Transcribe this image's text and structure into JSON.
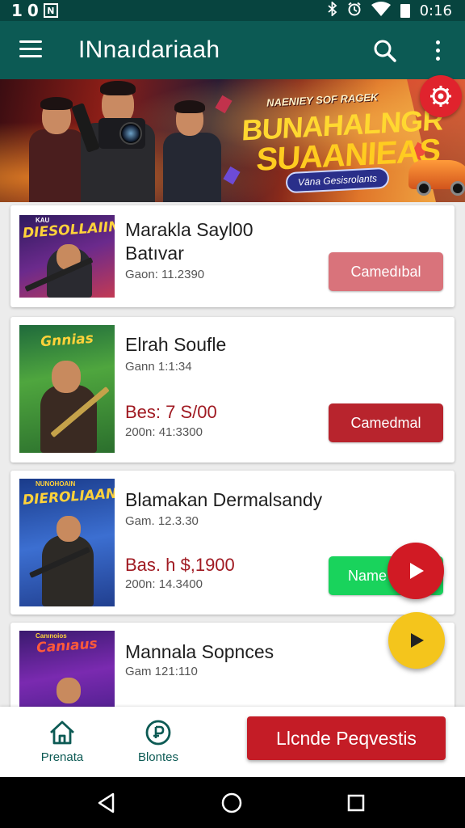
{
  "status_bar": {
    "left_text": "1",
    "left_digit": "0",
    "time": "0:16",
    "icons": [
      "notification-n-icon",
      "bluetooth-icon",
      "alarm-icon",
      "wifi-icon",
      "battery-icon"
    ]
  },
  "app_bar": {
    "title": "INnaıdariaah",
    "icons": [
      "menu-icon",
      "search-icon",
      "more-vert-icon"
    ]
  },
  "banner": {
    "small_text": "NAENIEY SOF RAGEK",
    "title_line1": "BUNAHALNGR",
    "title_line2": "SUAANIEAS",
    "pill_text": "Vāna Gesisrolants",
    "badge_icon": "gear-icon"
  },
  "games": [
    {
      "thumb_title": "DIESOLLAIIN",
      "thumb_sub": "KAU",
      "title": "Marakla Sayl00",
      "title2": "Batıvar",
      "meta": "Gaon: 11.2390",
      "price": "",
      "price_sub": "",
      "button": "Camedıbal",
      "button_color": "#d9737b"
    },
    {
      "thumb_title": "Gnnias",
      "thumb_sub": "",
      "title": "Elrah Soufle",
      "title2": "",
      "meta": "Gann 1:1:34",
      "price": "Bes: 7 S/00",
      "price_sub": "200n: 41:3300",
      "button": "Camedmal",
      "button_color": "#b8242d"
    },
    {
      "thumb_title": "DIEROLIAAN",
      "thumb_sub": "NUNOHOAIN",
      "title": "Blamakan Dermalsandy",
      "title2": "",
      "meta": "Gam. 12.3.30",
      "price": "Bas. h $,1900",
      "price_sub": "200n: 14.3400",
      "button": "Name",
      "button_color": "#19d35c"
    },
    {
      "thumb_title": "Canıaus",
      "thumb_sub": "Canınoios",
      "title": "Mannala Sopnces",
      "title2": "",
      "meta": "Gam 121:110",
      "price": "",
      "price_sub": "",
      "button": "",
      "button_color": "#19d35c"
    }
  ],
  "fabs": [
    {
      "icon": "play-icon",
      "color": "#d11a24"
    },
    {
      "icon": "play-icon",
      "color": "#f4c51c"
    }
  ],
  "bottom_nav": {
    "items": [
      {
        "label": "Prenata",
        "icon": "home-icon"
      },
      {
        "label": "Blontes",
        "icon": "coin-icon"
      }
    ],
    "cta_label": "Llcnde Peqvestis"
  },
  "system_nav": [
    "back-icon",
    "home-circle-icon",
    "recents-icon"
  ]
}
